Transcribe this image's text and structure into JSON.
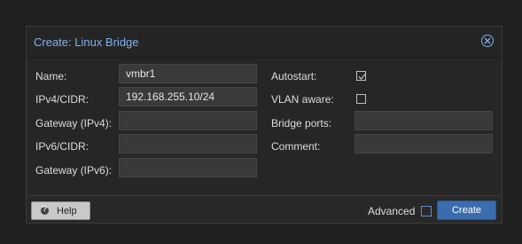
{
  "dialog": {
    "title": "Create: Linux Bridge",
    "close_icon": "close-circle-icon"
  },
  "left_fields": [
    {
      "label": "Name:",
      "value": "vmbr1"
    },
    {
      "label": "IPv4/CIDR:",
      "value": "192.168.255.10/24"
    },
    {
      "label": "Gateway (IPv4):",
      "value": ""
    },
    {
      "label": "IPv6/CIDR:",
      "value": ""
    },
    {
      "label": "Gateway (IPv6):",
      "value": ""
    }
  ],
  "right_fields": {
    "autostart": {
      "label": "Autostart:",
      "checked": true
    },
    "vlan_aware": {
      "label": "VLAN aware:",
      "checked": false
    },
    "bridge_ports": {
      "label": "Bridge ports:",
      "value": ""
    },
    "comment": {
      "label": "Comment:",
      "value": ""
    }
  },
  "footer": {
    "help_label": "Help",
    "help_icon": "help-icon",
    "advanced_label": "Advanced",
    "advanced_checked": false,
    "create_label": "Create"
  },
  "colors": {
    "accent": "#7fb0ea",
    "primary_button": "#3a6db0"
  }
}
